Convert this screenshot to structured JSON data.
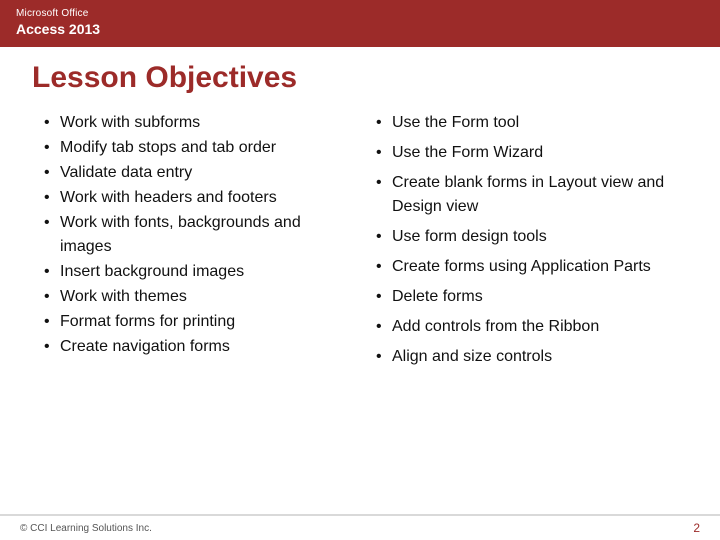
{
  "header": {
    "brand": "Microsoft Office",
    "product": "Access 2013"
  },
  "title": "Lesson Objectives",
  "left_bullets": [
    "Work with subforms",
    "Modify tab stops and tab order",
    "Validate data entry",
    "Work with headers and footers",
    "Work with fonts, backgrounds and images",
    "Insert background images",
    "Work with themes",
    "Format forms for printing",
    "Create navigation forms"
  ],
  "right_bullets": [
    "Use the Form tool",
    "Use the Form Wizard",
    "Create blank forms in Layout view and Design view",
    "Use form design tools",
    "Create forms using Application Parts",
    "Delete forms",
    "Add controls from the Ribbon",
    "Align and size controls"
  ],
  "footer": {
    "copyright": "© CCI Learning Solutions Inc.",
    "page_number": "2"
  }
}
